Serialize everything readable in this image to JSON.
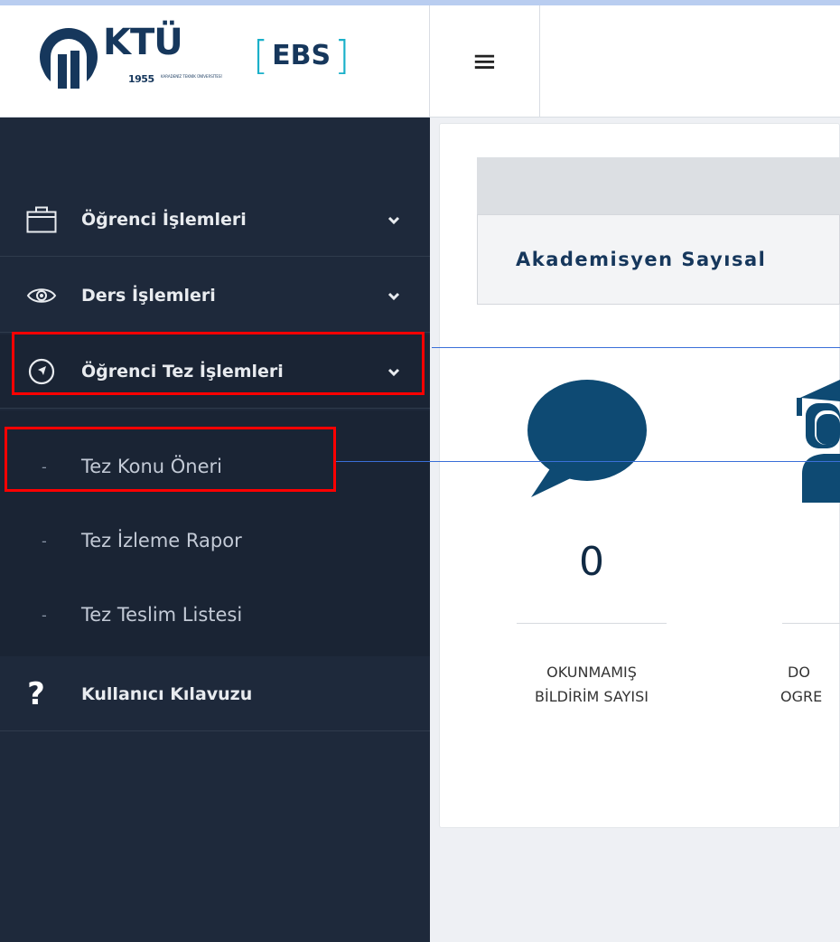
{
  "brand": {
    "name": "KTÜ",
    "year": "1955",
    "tagline": "KARADENİZ TEKNİK ÜNİVERSİTESİ",
    "module": "EBS"
  },
  "header": {
    "menu_toggle_glyph": "≡"
  },
  "sidebar": {
    "items": [
      {
        "label": "Öğrenci İşlemleri",
        "icon": "briefcase-icon"
      },
      {
        "label": "Ders İşlemleri",
        "icon": "eye-icon"
      },
      {
        "label": "Öğrenci Tez İşlemleri",
        "icon": "compass-icon",
        "expanded": true
      },
      {
        "label": "Kullanıcı Kılavuzu",
        "icon": "question-icon"
      }
    ],
    "thesis_submenu": [
      {
        "label": "Tez Konu Öneri"
      },
      {
        "label": "Tez İzleme Rapor"
      },
      {
        "label": "Tez Teslim Listesi"
      }
    ],
    "submenu_dash": "-"
  },
  "main": {
    "tab_label": "Akademisyen Sayısal",
    "stats": [
      {
        "value": "0",
        "label_line1": "OKUNMAMIŞ",
        "label_line2": "BİLDİRİM SAYISI",
        "icon": "speech-bubble-icon"
      },
      {
        "value": "",
        "label_line1": "DO",
        "label_line2": "OGRE",
        "icon": "graduate-icon"
      }
    ]
  },
  "colors": {
    "sidebar_bg": "#1e293b",
    "brand_navy": "#16375c",
    "brand_teal": "#1ab0c9",
    "highlight": "#ff0000",
    "icon_blue": "#0e4a73"
  }
}
